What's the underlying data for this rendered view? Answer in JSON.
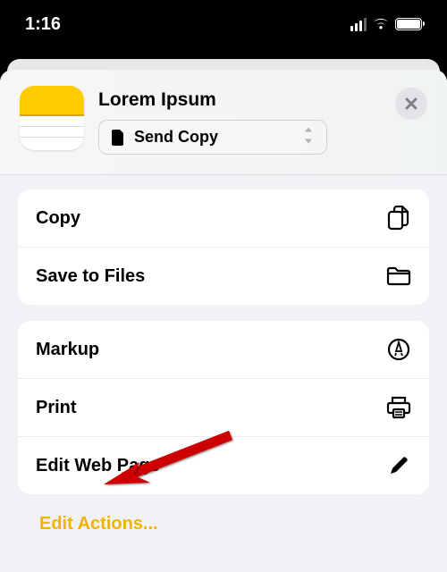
{
  "status": {
    "time": "1:16"
  },
  "header": {
    "title": "Lorem Ipsum",
    "send_copy_label": "Send Copy"
  },
  "groups": [
    {
      "items": [
        {
          "label": "Copy",
          "icon": "doc-on-doc-icon"
        },
        {
          "label": "Save to Files",
          "icon": "folder-icon"
        }
      ]
    },
    {
      "items": [
        {
          "label": "Markup",
          "icon": "markup-icon"
        },
        {
          "label": "Print",
          "icon": "printer-icon"
        },
        {
          "label": "Edit Web Page",
          "icon": "pencil-icon"
        }
      ]
    }
  ],
  "footer": {
    "edit_actions": "Edit Actions..."
  }
}
